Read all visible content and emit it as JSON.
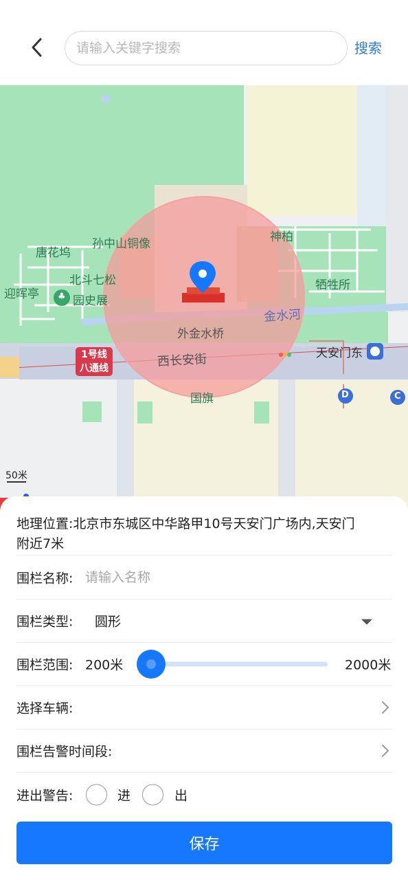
{
  "header": {
    "search_placeholder": "请输入关键字搜索",
    "search_label": "搜索"
  },
  "map": {
    "labels": {
      "tanghuawu": "唐花坞",
      "sun_statue": "孙中山铜像",
      "shenbo": "神柏",
      "beidou": "北斗七松",
      "sacrifice": "牺牲所",
      "yinghui": "迎晖亭",
      "history": "园史展",
      "jinshui": "金水河",
      "waijin": "外金水桥",
      "xichang": "西长安街",
      "tiananmen_east": "天安门东",
      "guoqi": "国旗",
      "metro_line1": "1号线",
      "metro_line2": "八通线",
      "exit_d": "D",
      "exit_c": "C"
    },
    "scale_label": "50米",
    "fence_color": "#f2a0a0",
    "marker_color": "#1677ff"
  },
  "form": {
    "geo_label": "地理位置:",
    "geo_address_line1": "北京市东城区中华路甲10号天安门广场内,天安门",
    "geo_address_line2": "附近7米",
    "name_label": "围栏名称:",
    "name_placeholder": "请输入名称",
    "type_label": "围栏类型:",
    "type_value": "圆形",
    "range_label": "围栏范围:",
    "range_min": "200米",
    "range_max": "2000米",
    "vehicle_label": "选择车辆:",
    "period_label": "围栏告警时间段:",
    "warn_label": "进出警告:",
    "warn_in": "进",
    "warn_out": "出",
    "save_label": "保存"
  },
  "colors": {
    "primary": "#1677ff",
    "link": "#2f7bd6"
  }
}
